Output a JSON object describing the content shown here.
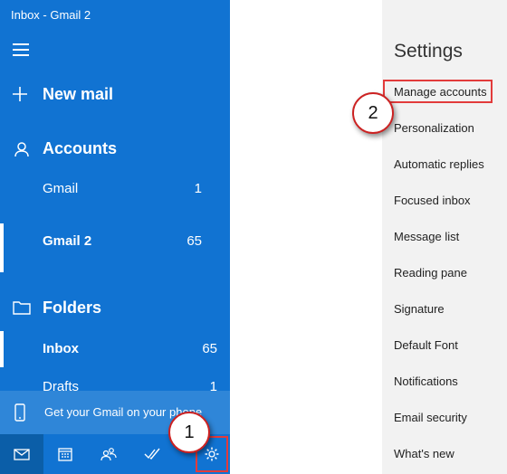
{
  "window": {
    "title": "Inbox - Gmail 2"
  },
  "sidebar": {
    "new_mail": "New mail",
    "accounts_header": "Accounts",
    "accounts": [
      {
        "name": "Gmail",
        "count": "1"
      },
      {
        "name": "Gmail 2",
        "count": "65"
      }
    ],
    "folders_header": "Folders",
    "folders": [
      {
        "name": "Inbox",
        "count": "65"
      },
      {
        "name": "Drafts",
        "count": "1"
      }
    ],
    "promo": "Get your Gmail on your phone"
  },
  "bottom_bar": {
    "icons": [
      "mail-icon",
      "calendar-icon",
      "people-icon",
      "todo-icon",
      "settings-icon"
    ]
  },
  "callouts": {
    "one": "1",
    "two": "2"
  },
  "settings": {
    "title": "Settings",
    "items": [
      "Manage accounts",
      "Personalization",
      "Automatic replies",
      "Focused inbox",
      "Message list",
      "Reading pane",
      "Signature",
      "Default Font",
      "Notifications",
      "Email security",
      "What's new"
    ]
  },
  "colors": {
    "sidebar": "#1173d2",
    "highlight": "#e23b3b",
    "pane": "#f2f2f2"
  }
}
